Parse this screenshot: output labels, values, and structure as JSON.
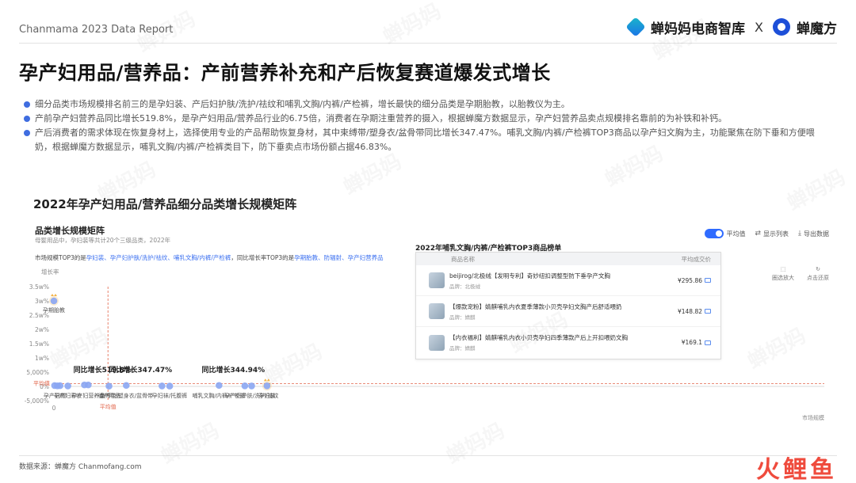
{
  "header": {
    "report": "Chanmama 2023 Data Report",
    "brand_left": "蝉妈妈电商智库",
    "brand_sep": "X",
    "brand_right": "蝉魔方"
  },
  "title": "孕产妇用品/营养品：产前营养补充和产后恢复赛道爆发式增长",
  "bullets": [
    "细分品类市场规模排名前三的是孕妇装、产后妇护肤/洗护/祛纹和哺乳文胸/内裤/产检裤，增长最快的细分品类是孕期胎教，以胎教仪为主。",
    "产前孕产妇营养品同比增长519.8%，是孕产妇用品/营养品行业的6.75倍，消费者在孕期注重营养的摄入，根据蝉魔方数据显示，孕产妇营养品卖点规模排名靠前的为补铁和补钙。",
    "产后消费者的需求体现在恢复身材上，选择使用专业的产品帮助恢复身材，其中束缚带/塑身衣/盆骨带同比增长347.47%。哺乳文胸/内裤/产检裤TOP3商品以孕产妇文胸为主，功能聚焦在防下垂和方便喂奶，根据蝉魔方数据显示，哺乳文胸/内裤/产检裤类目下，防下垂卖点市场份额占据46.83%。"
  ],
  "section_title": "2022年孕产妇用品/营养品细分品类增长规模矩阵",
  "panel": {
    "title": "品类增长规模矩阵",
    "subtitle": "母婴用品中，孕妇装等共计20个三级品类，2022年",
    "desc_prefix": "市场规模TOP3的是",
    "desc_top_size": "孕妇装、孕产妇护肤/洗护/祛纹、哺乳文胸/内裤/产检裤",
    "desc_mid": "，同比增长率TOP3的是",
    "desc_top_growth": "孕期胎教、防辐射、孕产妇营养品",
    "toolbar": {
      "avg_label": "平均值",
      "show_list": "显示列表",
      "export": "导出数据"
    },
    "side_tools": {
      "zoom": "圈选放大",
      "reset": "点击还原"
    }
  },
  "popup": {
    "title": "2022年哺乳文胸/内裤/产检裤TOP3商品榜单",
    "col_name": "商品名称",
    "col_price": "平均成交价",
    "products": [
      {
        "name": "beijirog/北极绒【发明专利】奇妙纽扣调整型防下垂孕产文胸",
        "shop": "品牌：北极绒",
        "price": "¥295.86"
      },
      {
        "name": "【爆款宠粉】婧麒哺乳内衣夏季薄款小贝壳孕妇文胸产后舒适喂奶",
        "shop": "品牌：婧麒",
        "price": "¥148.82"
      },
      {
        "name": "【内衣福利】婧麒哺乳内衣小贝壳孕妇四季薄款产后上开扣喂奶文胸",
        "shop": "品牌：婧麒",
        "price": "¥169.1"
      }
    ]
  },
  "chart_data": {
    "type": "scatter",
    "ylabel": "增长率",
    "xlabel": "市场规模",
    "y_ticks": [
      "3.5w%",
      "3w%",
      "2.5w%",
      "2w%",
      "1.5w%",
      "1w%",
      "5,000%",
      "0%",
      "-5,000%"
    ],
    "y_tick_values": [
      35000,
      30000,
      25000,
      20000,
      15000,
      10000,
      5000,
      0,
      -5000
    ],
    "ylim": [
      -5000,
      35000
    ],
    "x_zero_label": "0",
    "avg_y_label": "平均值",
    "avg_x_label": "平均值",
    "avg_y": 1000,
    "avg_x": 0.31,
    "points": [
      {
        "label": "孕期胎教",
        "x": 0.0,
        "y": 30000,
        "highlight": "top-growth"
      },
      {
        "label": "孕产妇帽",
        "x": 0.004,
        "y": 300
      },
      {
        "label": "",
        "x": 0.02,
        "y": 200
      },
      {
        "label": "",
        "x": 0.035,
        "y": 250
      },
      {
        "label": "孕产妇彩妆",
        "x": 0.08,
        "y": 150
      },
      {
        "label": "",
        "x": 0.175,
        "y": 519.8
      },
      {
        "label": "孕产妇营养品",
        "x": 0.197,
        "y": 519.8
      },
      {
        "label": "待产用品",
        "x": 0.316,
        "y": 100
      },
      {
        "label": "束缚带/塑身衣/盆骨带",
        "x": 0.415,
        "y": 347.47
      },
      {
        "label": "",
        "x": 0.62,
        "y": 150
      },
      {
        "label": "孕妇袜/托腹裤",
        "x": 0.664,
        "y": 120
      },
      {
        "label": "哺乳文胸/内裤/产检裤",
        "x": 0.947,
        "y": 344.94
      },
      {
        "label": "",
        "x": 1.095,
        "y": 180
      },
      {
        "label": "孕产妇护肤/洗护/祛纹",
        "x": 1.134,
        "y": 160
      },
      {
        "label": "孕妇装",
        "x": 1.222,
        "y": 200,
        "highlight": "top-size"
      }
    ],
    "annotations": [
      {
        "text": "同比增长519.8%",
        "x": 0.197
      },
      {
        "text": "同比增长347.47%",
        "x": 0.415
      },
      {
        "text": "同比增长344.94%",
        "x": 0.947
      }
    ],
    "grid": false,
    "point_color": "#8aa6f3",
    "highlight_color": "#f3b44a",
    "avg_line_color": "#e2654a"
  },
  "footer": "数据来源：蝉魔方 Chanmofang.com",
  "wm_logo": "火鲤鱼",
  "watermark_text": "蝉妈妈"
}
